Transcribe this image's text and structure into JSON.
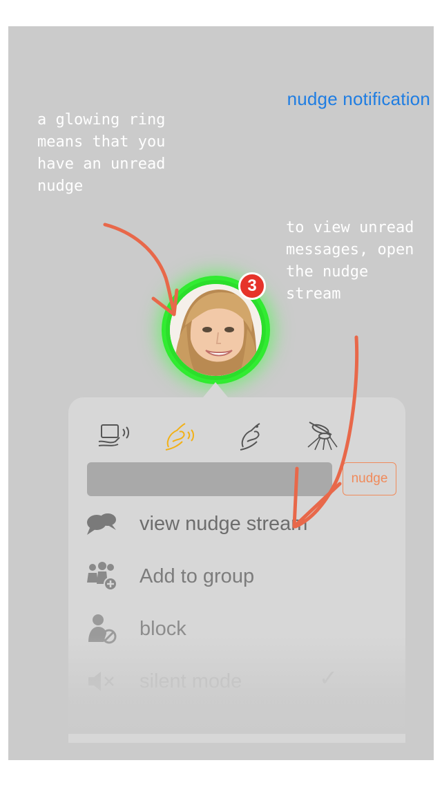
{
  "screen_title": "nudge notification",
  "annotations": {
    "left": "a glowing ring means that you have an unread nudge",
    "right": "to view unread messages, open the nudge stream"
  },
  "avatar": {
    "badge_count": "3",
    "ring_color": "#2bde2b",
    "badge_color": "#e6332a"
  },
  "nudge_types": [
    "screen-nudge-icon",
    "hand-wave-nudge-icon",
    "hand-bird-nudge-icon",
    "mosquito-nudge-icon"
  ],
  "nudge_input": {
    "value": "",
    "placeholder": ""
  },
  "nudge_button_label": "nudge",
  "menu": [
    {
      "label": "view nudge stream",
      "icon": "chat-bubbles-icon"
    },
    {
      "label": "Add to group",
      "icon": "group-add-icon"
    },
    {
      "label": "block",
      "icon": "block-user-icon"
    },
    {
      "label": "silent mode",
      "icon": "mute-icon"
    }
  ],
  "colors": {
    "accent_orange": "#f08a5a",
    "title_blue": "#1f7de2",
    "active_nudge": "#f2b015",
    "annotation_arrow": "#e8684a"
  }
}
